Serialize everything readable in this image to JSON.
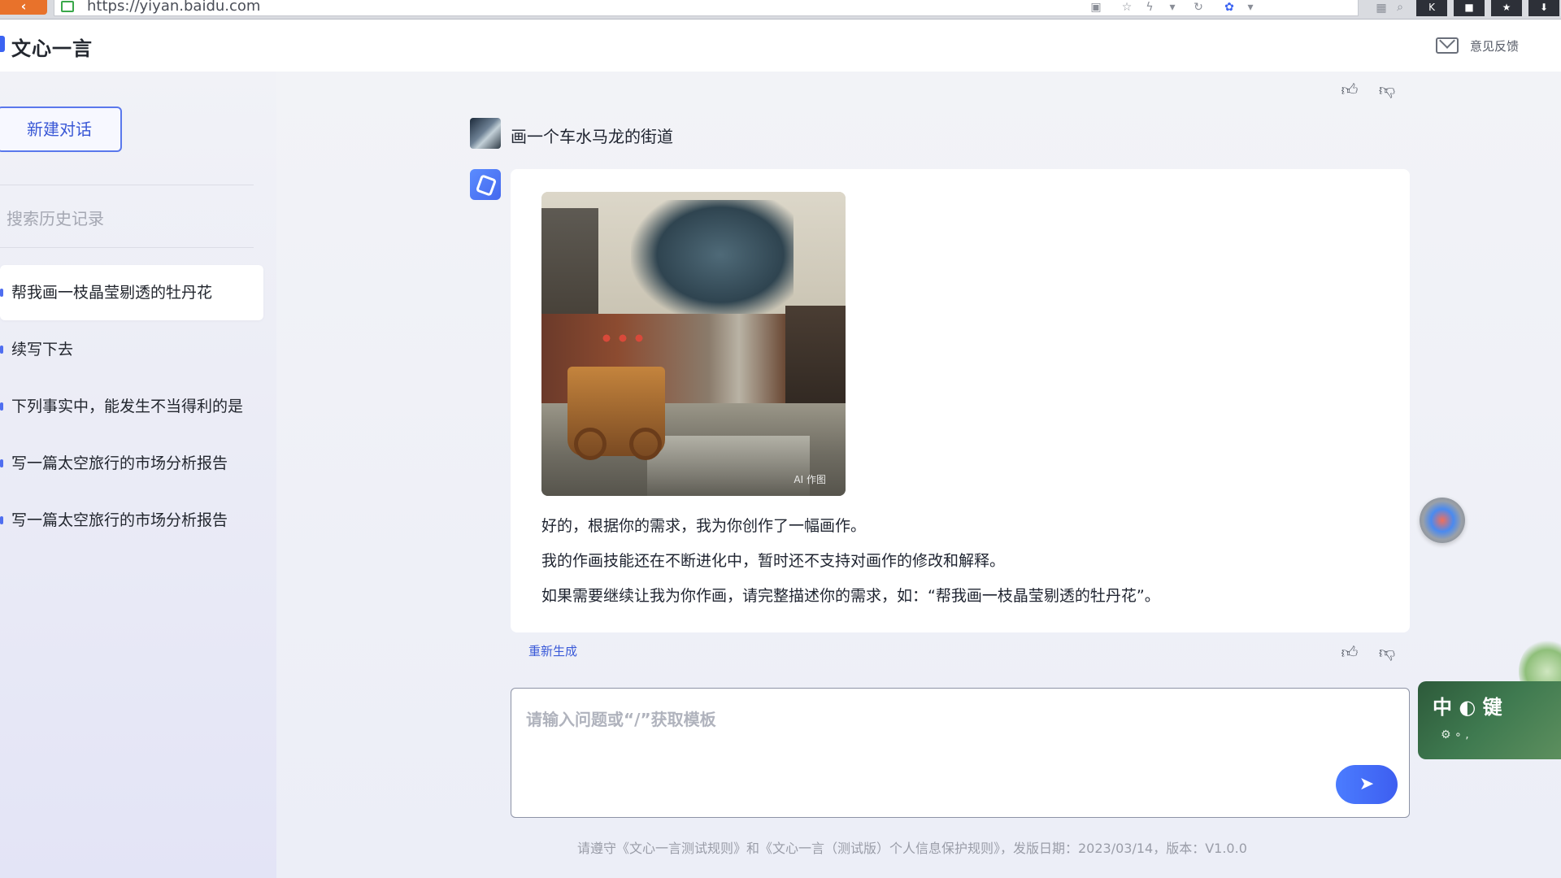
{
  "browser": {
    "url": "https://yiyan.baidu.com"
  },
  "header": {
    "brand": "文心一言",
    "feedback_label": "意见反馈"
  },
  "sidebar": {
    "new_chat_label": "新建对话",
    "search_placeholder": "搜索历史记录",
    "history": [
      {
        "label": "帮我画一枝晶莹剔透的牡丹花",
        "active": true
      },
      {
        "label": "续写下去",
        "active": false
      },
      {
        "label": "下列事实中，能发生不当得利的是",
        "active": false
      },
      {
        "label": "写一篇太空旅行的市场分析报告",
        "active": false
      },
      {
        "label": "写一篇太空旅行的市场分析报告",
        "active": false
      }
    ]
  },
  "chat": {
    "user_question": "画一个车水马龙的街道",
    "image_watermark": "AI 作图",
    "answer_lines": [
      "好的，根据你的需求，我为你创作了一幅画作。",
      "我的作画技能还在不断进化中，暂时还不支持对画作的修改和解释。",
      "如果需要继续让我为你作画，请完整描述你的需求，如：“帮我画一枝晶莹剔透的牡丹花”。"
    ],
    "regenerate_label": "重新生成"
  },
  "composer": {
    "placeholder": "请输入问题或“/”获取模板"
  },
  "footer": {
    "note": "请遵守《文心一言测试规则》和《文心一言（测试版）个人信息保护规则》，发版日期：2023/03/14，版本：V1.0.0"
  },
  "ime": {
    "label": "中 ◐ 键",
    "sub": "⚙ ∘ ,"
  },
  "colors": {
    "accent": "#3d5ef0",
    "sidebar_bg": "#eceef7",
    "link": "#3a5ad8"
  }
}
